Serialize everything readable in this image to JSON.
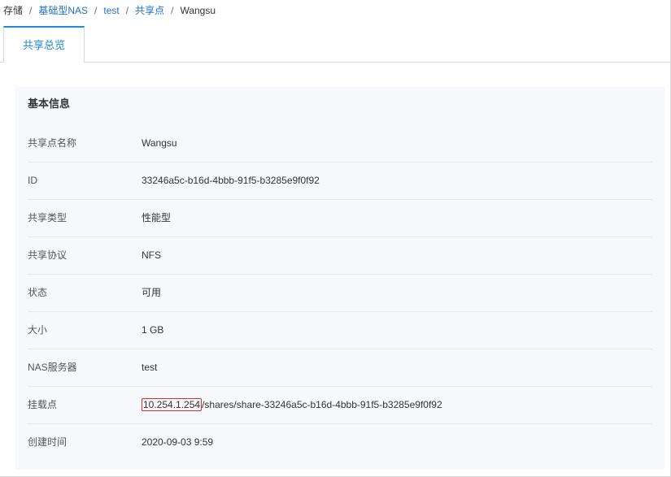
{
  "breadcrumb": {
    "root": "存储",
    "items": [
      "基础型NAS",
      "test",
      "共享点"
    ],
    "current": "Wangsu",
    "separator": "/"
  },
  "tabs": [
    {
      "label": "共享总览",
      "active": true
    }
  ],
  "basic_info": {
    "title": "基本信息",
    "rows": [
      {
        "label": "共享点名称",
        "value": "Wangsu"
      },
      {
        "label": "ID",
        "value": "33246a5c-b16d-4bbb-91f5-b3285e9f0f92"
      },
      {
        "label": "共享类型",
        "value": "性能型"
      },
      {
        "label": "共享协议",
        "value": "NFS"
      },
      {
        "label": "状态",
        "value": "可用"
      },
      {
        "label": "大小",
        "value": "1 GB"
      },
      {
        "label": "NAS服务器",
        "value": "test"
      },
      {
        "label": "挂载点",
        "value_ip": "10.254.1.254",
        "value_path": "/shares/share-33246a5c-b16d-4bbb-91f5-b3285e9f0f92"
      },
      {
        "label": "创建时间",
        "value": "2020-09-03 9:59"
      }
    ]
  },
  "colors": {
    "link": "#1e6fc8",
    "active_tab": "#1e88e5",
    "panel_bg": "#f6f8fb",
    "highlight_border": "#d0342c"
  }
}
